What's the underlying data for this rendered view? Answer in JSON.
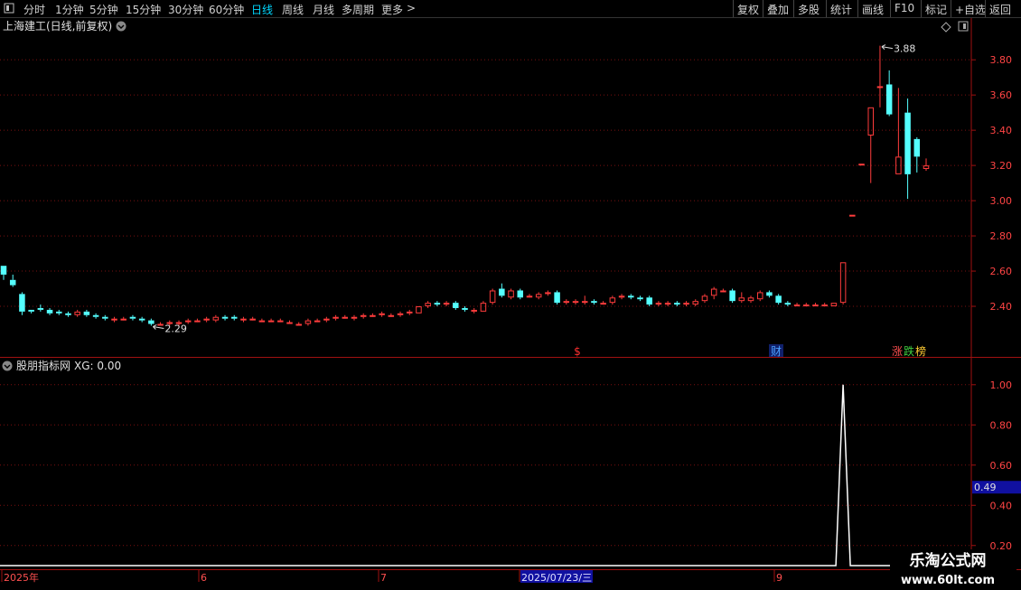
{
  "toolbar": {
    "window_icon": "window-icon",
    "periods": [
      "分时",
      "1分钟",
      "5分钟",
      "15分钟",
      "30分钟",
      "60分钟",
      "日线",
      "周线",
      "月线",
      "多周期",
      "更多"
    ],
    "active_period": "日线",
    "more_arrow": ">",
    "right_buttons": [
      "复权",
      "叠加",
      "多股",
      "统计",
      "画线",
      "F10",
      "标记",
      "+自选",
      "返回"
    ]
  },
  "main": {
    "title": "上海建工(日线,前复权)",
    "max_label": "3.88",
    "min_label": "2.29",
    "markers": [
      {
        "text": "$",
        "color": "#ff3030"
      },
      {
        "text": "财",
        "color": "#4aa0ff"
      },
      {
        "text": "涨",
        "color": "#ff5050"
      },
      {
        "text": "跌",
        "color": "#40d040"
      },
      {
        "text": "榜",
        "color": "#ffcc33"
      }
    ]
  },
  "indicator": {
    "title": "股朋指标网",
    "xg_label": "XG: 0.00",
    "current_value": "0.49"
  },
  "xaxis": {
    "labels": [
      "2025年",
      "6",
      "7",
      "2025/07/23/三",
      "9"
    ]
  },
  "watermark": {
    "line1": "乐淘公式网",
    "line2": "www.60lt.com"
  },
  "colors": {
    "up": "#ff3c3c",
    "down": "#54ffff",
    "grid": "#7a1010",
    "axis": "#a01010",
    "highlight": "#1010a0"
  },
  "chart_data": [
    {
      "type": "candlestick",
      "title": "上海建工(日线,前复权)",
      "ylim": [
        2.2,
        3.96
      ],
      "y_ticks": [
        2.4,
        2.6,
        2.8,
        3.0,
        3.2,
        3.4,
        3.6,
        3.8
      ],
      "annotations": [
        {
          "text": "3.88",
          "kind": "max"
        },
        {
          "text": "2.29",
          "kind": "min"
        }
      ],
      "candles_ohlc": [
        [
          2.63,
          2.63,
          2.55,
          2.58
        ],
        [
          2.55,
          2.58,
          2.51,
          2.52
        ],
        [
          2.47,
          2.48,
          2.35,
          2.37
        ],
        [
          2.38,
          2.38,
          2.36,
          2.37
        ],
        [
          2.39,
          2.41,
          2.37,
          2.38
        ],
        [
          2.38,
          2.39,
          2.35,
          2.36
        ],
        [
          2.37,
          2.38,
          2.35,
          2.36
        ],
        [
          2.36,
          2.37,
          2.34,
          2.35
        ],
        [
          2.35,
          2.38,
          2.34,
          2.37
        ],
        [
          2.37,
          2.38,
          2.34,
          2.35
        ],
        [
          2.35,
          2.36,
          2.33,
          2.34
        ],
        [
          2.34,
          2.35,
          2.32,
          2.33
        ],
        [
          2.32,
          2.34,
          2.31,
          2.33
        ],
        [
          2.33,
          2.34,
          2.32,
          2.33
        ],
        [
          2.34,
          2.35,
          2.32,
          2.33
        ],
        [
          2.33,
          2.34,
          2.31,
          2.32
        ],
        [
          2.32,
          2.33,
          2.29,
          2.3
        ],
        [
          2.3,
          2.31,
          2.29,
          2.3
        ],
        [
          2.3,
          2.32,
          2.29,
          2.31
        ],
        [
          2.3,
          2.32,
          2.29,
          2.31
        ],
        [
          2.31,
          2.33,
          2.3,
          2.32
        ],
        [
          2.32,
          2.33,
          2.31,
          2.32
        ],
        [
          2.32,
          2.34,
          2.31,
          2.33
        ],
        [
          2.32,
          2.35,
          2.31,
          2.34
        ],
        [
          2.34,
          2.35,
          2.32,
          2.33
        ],
        [
          2.34,
          2.35,
          2.32,
          2.33
        ],
        [
          2.32,
          2.34,
          2.31,
          2.33
        ],
        [
          2.33,
          2.34,
          2.32,
          2.33
        ],
        [
          2.32,
          2.33,
          2.31,
          2.32
        ],
        [
          2.32,
          2.33,
          2.31,
          2.32
        ],
        [
          2.32,
          2.33,
          2.31,
          2.32
        ],
        [
          2.31,
          2.32,
          2.3,
          2.31
        ],
        [
          2.3,
          2.31,
          2.29,
          2.3
        ],
        [
          2.3,
          2.33,
          2.29,
          2.32
        ],
        [
          2.32,
          2.33,
          2.31,
          2.32
        ],
        [
          2.32,
          2.34,
          2.31,
          2.33
        ],
        [
          2.33,
          2.35,
          2.32,
          2.34
        ],
        [
          2.34,
          2.35,
          2.33,
          2.34
        ],
        [
          2.33,
          2.35,
          2.32,
          2.34
        ],
        [
          2.34,
          2.36,
          2.33,
          2.35
        ],
        [
          2.35,
          2.36,
          2.34,
          2.35
        ],
        [
          2.35,
          2.37,
          2.34,
          2.36
        ],
        [
          2.35,
          2.36,
          2.34,
          2.35
        ],
        [
          2.35,
          2.37,
          2.34,
          2.36
        ],
        [
          2.36,
          2.38,
          2.35,
          2.37
        ],
        [
          2.36,
          2.4,
          2.36,
          2.4
        ],
        [
          2.4,
          2.43,
          2.39,
          2.42
        ],
        [
          2.42,
          2.43,
          2.4,
          2.41
        ],
        [
          2.41,
          2.43,
          2.4,
          2.42
        ],
        [
          2.42,
          2.43,
          2.38,
          2.39
        ],
        [
          2.39,
          2.4,
          2.37,
          2.38
        ],
        [
          2.37,
          2.39,
          2.36,
          2.38
        ],
        [
          2.37,
          2.43,
          2.37,
          2.42
        ],
        [
          2.42,
          2.5,
          2.41,
          2.49
        ],
        [
          2.5,
          2.53,
          2.45,
          2.46
        ],
        [
          2.45,
          2.5,
          2.44,
          2.49
        ],
        [
          2.49,
          2.5,
          2.44,
          2.45
        ],
        [
          2.46,
          2.47,
          2.45,
          2.46
        ],
        [
          2.45,
          2.48,
          2.44,
          2.47
        ],
        [
          2.47,
          2.49,
          2.46,
          2.48
        ],
        [
          2.48,
          2.49,
          2.41,
          2.42
        ],
        [
          2.42,
          2.44,
          2.41,
          2.43
        ],
        [
          2.42,
          2.44,
          2.41,
          2.43
        ],
        [
          2.43,
          2.46,
          2.41,
          2.43
        ],
        [
          2.43,
          2.44,
          2.41,
          2.42
        ],
        [
          2.42,
          2.43,
          2.41,
          2.42
        ],
        [
          2.42,
          2.46,
          2.41,
          2.45
        ],
        [
          2.45,
          2.47,
          2.44,
          2.46
        ],
        [
          2.46,
          2.47,
          2.44,
          2.45
        ],
        [
          2.45,
          2.46,
          2.43,
          2.44
        ],
        [
          2.45,
          2.46,
          2.4,
          2.41
        ],
        [
          2.41,
          2.43,
          2.4,
          2.42
        ],
        [
          2.41,
          2.43,
          2.4,
          2.42
        ],
        [
          2.42,
          2.43,
          2.4,
          2.41
        ],
        [
          2.41,
          2.43,
          2.4,
          2.42
        ],
        [
          2.41,
          2.44,
          2.4,
          2.43
        ],
        [
          2.43,
          2.47,
          2.42,
          2.46
        ],
        [
          2.46,
          2.51,
          2.44,
          2.5
        ],
        [
          2.49,
          2.5,
          2.48,
          2.49
        ],
        [
          2.49,
          2.5,
          2.42,
          2.43
        ],
        [
          2.43,
          2.48,
          2.42,
          2.45
        ],
        [
          2.43,
          2.46,
          2.42,
          2.45
        ],
        [
          2.44,
          2.49,
          2.43,
          2.48
        ],
        [
          2.48,
          2.49,
          2.45,
          2.46
        ],
        [
          2.46,
          2.47,
          2.41,
          2.42
        ],
        [
          2.42,
          2.43,
          2.4,
          2.41
        ],
        [
          2.41,
          2.42,
          2.4,
          2.41
        ],
        [
          2.41,
          2.42,
          2.4,
          2.41
        ],
        [
          2.41,
          2.42,
          2.4,
          2.41
        ],
        [
          2.41,
          2.42,
          2.4,
          2.41
        ],
        [
          2.4,
          2.42,
          2.4,
          2.42
        ],
        [
          2.42,
          2.65,
          2.41,
          2.65
        ],
        [
          2.92,
          2.92,
          2.92,
          2.92
        ],
        [
          3.21,
          3.21,
          3.21,
          3.21
        ],
        [
          3.37,
          3.53,
          3.1,
          3.53
        ],
        [
          3.65,
          3.88,
          3.53,
          3.65
        ],
        [
          3.66,
          3.74,
          3.48,
          3.49
        ],
        [
          3.15,
          3.64,
          3.15,
          3.25
        ],
        [
          3.5,
          3.58,
          3.01,
          3.15
        ],
        [
          3.35,
          3.36,
          3.16,
          3.25
        ],
        [
          3.18,
          3.24,
          3.17,
          3.2
        ]
      ]
    },
    {
      "type": "line",
      "title": "股朋指标网",
      "ylim": [
        0.1,
        1.08
      ],
      "y_ticks": [
        0.2,
        0.4,
        0.6,
        0.8,
        1.0
      ],
      "series": [
        {
          "name": "XG",
          "spike_index": 91,
          "values_note": "0 everywhere except 1 at one bar"
        }
      ],
      "current_value": 0.49
    }
  ]
}
